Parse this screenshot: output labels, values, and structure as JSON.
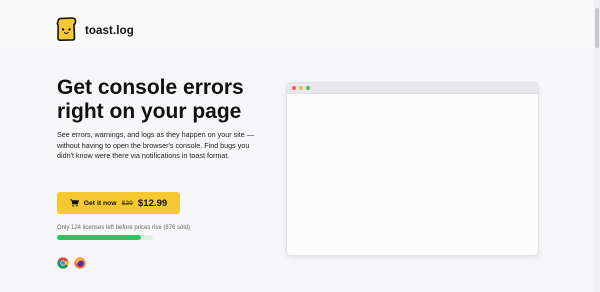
{
  "brand": {
    "name": "toast.log",
    "logo_icon": "toast-logo-icon"
  },
  "hero": {
    "headline": "Get console errors right on your page",
    "description": "See errors, warnings, and logs as they happen on your site — without having to open the browser's console. Find bugs you didn't know were there via notifications in toast format."
  },
  "cta": {
    "label": "Get it now",
    "old_price": "$20",
    "new_price": "$12.99",
    "icon": "cart-icon",
    "color": "#f6c831"
  },
  "licenses": {
    "text": "Only 124 licenses left before prices rise (876 sold)",
    "progress_fraction": 0.876,
    "bar_color": "#2bc463"
  },
  "browsers": [
    {
      "name": "chrome-icon"
    },
    {
      "name": "firefox-icon"
    }
  ],
  "preview_window": {
    "dot_colors": [
      "#ee5d55",
      "#f4bd3a",
      "#3fc64a"
    ]
  }
}
